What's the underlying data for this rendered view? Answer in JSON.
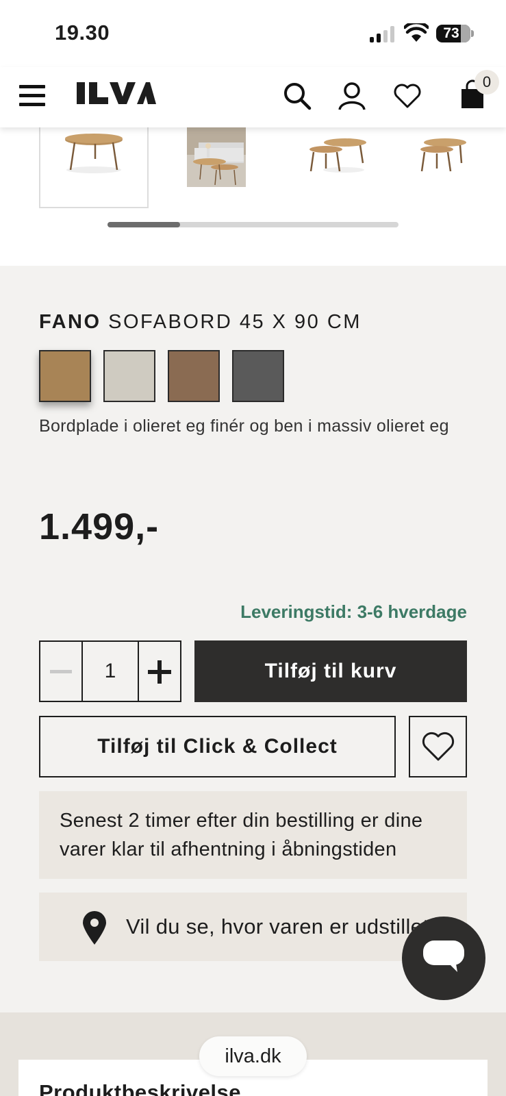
{
  "status_bar": {
    "time": "19.30",
    "battery": "73",
    "battery_level": 0.73
  },
  "header": {
    "brand": "ILVA",
    "cart_count": "0",
    "icons": [
      "menu-icon",
      "search-icon",
      "account-icon",
      "wishlist-icon",
      "cart-icon"
    ]
  },
  "gallery": {
    "thumbnail_count": 4,
    "selected_index": 0,
    "scroll_position": 0.25
  },
  "product": {
    "brand": "FANO",
    "name": "SOFABORD 45 X 90 CM",
    "swatches": [
      {
        "name": "oak",
        "color": "#a88456"
      },
      {
        "name": "light-grey",
        "color": "#cfcbc1"
      },
      {
        "name": "brown",
        "color": "#8a6b52"
      },
      {
        "name": "dark-grey",
        "color": "#5a5a5a"
      }
    ],
    "selected_swatch": 0,
    "description": "Bordplade i olieret eg finér og ben i massiv olieret eg",
    "price": "1.499,-",
    "delivery": "Leveringstid: 3-6 hverdage",
    "quantity": "1",
    "add_to_cart": "Tilføj til kurv",
    "click_collect": "Tilføj til Click & Collect",
    "pickup_info": "Senest 2 timer efter din bestilling er dine varer klar til afhentning i åbningstiden",
    "store_link": "Vil du se, hvor varen er udstillet?"
  },
  "bottom": {
    "section_heading": "Produktbeskrivelse",
    "url": "ilva.dk"
  },
  "colors": {
    "accent_green": "#3d7a65",
    "dark_button": "#2e2d2c",
    "panel": "#ebe7e1"
  }
}
